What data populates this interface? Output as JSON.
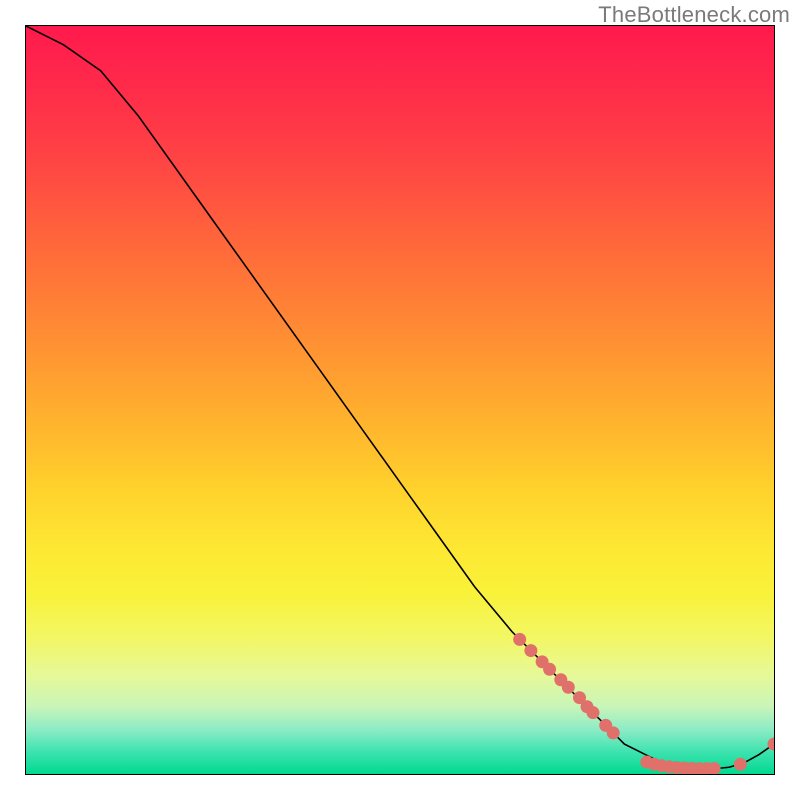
{
  "watermark": "TheBottleneck.com",
  "chart_data": {
    "type": "line",
    "title": "",
    "xlabel": "",
    "ylabel": "",
    "xlim": [
      0,
      100
    ],
    "ylim": [
      0,
      100
    ],
    "grid": false,
    "legend": false,
    "series": [
      {
        "name": "bottleneck-curve",
        "x": [
          0,
          5,
          10,
          15,
          20,
          25,
          30,
          35,
          40,
          45,
          50,
          55,
          60,
          65,
          70,
          72,
          75,
          78,
          80,
          82,
          84,
          86,
          88,
          90,
          92,
          94,
          96,
          98,
          100
        ],
        "y": [
          100,
          97.5,
          94,
          88,
          81,
          74,
          67,
          60,
          53,
          46,
          39,
          32,
          25,
          19,
          14,
          12,
          9,
          6,
          4,
          3,
          2,
          1.2,
          0.8,
          0.7,
          0.7,
          0.9,
          1.5,
          2.6,
          4.0
        ],
        "color": "#000000",
        "linewidth": 1.6
      }
    ],
    "markers_upper": {
      "name": "upper-dot-cluster",
      "color": "#e0706a",
      "radius": 6.5,
      "points": [
        {
          "x": 66,
          "y": 18.0
        },
        {
          "x": 67.5,
          "y": 16.5
        },
        {
          "x": 69,
          "y": 15.0
        },
        {
          "x": 70,
          "y": 14.0
        },
        {
          "x": 71.5,
          "y": 12.6
        },
        {
          "x": 72.5,
          "y": 11.6
        },
        {
          "x": 74,
          "y": 10.2
        },
        {
          "x": 75,
          "y": 9.0
        },
        {
          "x": 75.8,
          "y": 8.2
        },
        {
          "x": 77.5,
          "y": 6.5
        },
        {
          "x": 78.5,
          "y": 5.5
        }
      ]
    },
    "markers_lower": {
      "name": "lower-dot-cluster",
      "color": "#e0706a",
      "radius": 6.5,
      "points": [
        {
          "x": 83,
          "y": 1.6
        },
        {
          "x": 84,
          "y": 1.3
        },
        {
          "x": 85,
          "y": 1.1
        },
        {
          "x": 86,
          "y": 0.95
        },
        {
          "x": 87,
          "y": 0.85
        },
        {
          "x": 88,
          "y": 0.8
        },
        {
          "x": 89,
          "y": 0.75
        },
        {
          "x": 90,
          "y": 0.72
        },
        {
          "x": 91,
          "y": 0.72
        },
        {
          "x": 92,
          "y": 0.73
        },
        {
          "x": 95.5,
          "y": 1.3
        }
      ]
    },
    "markers_end": {
      "name": "end-dot",
      "color": "#e0706a",
      "radius": 6.5,
      "points": [
        {
          "x": 100,
          "y": 4.0
        }
      ]
    }
  }
}
